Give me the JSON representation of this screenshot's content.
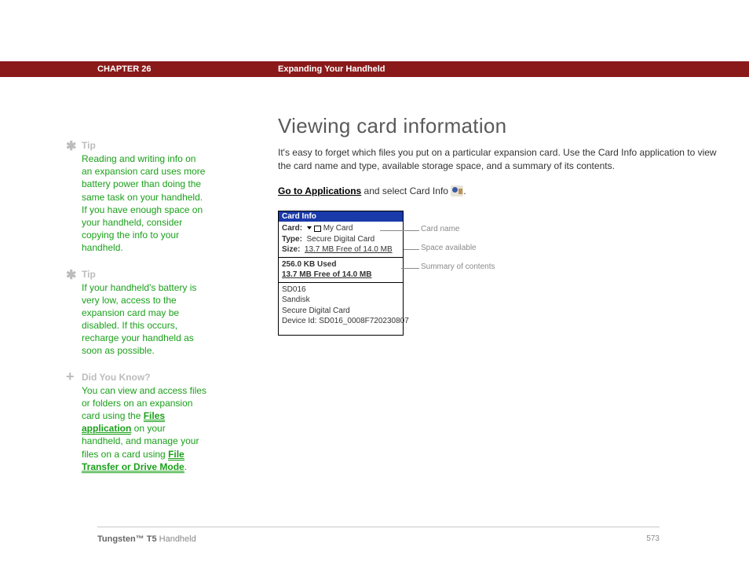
{
  "header": {
    "chapter": "CHAPTER 26",
    "title": "Expanding Your Handheld"
  },
  "sidebar": {
    "tip1": {
      "label": "Tip",
      "body": "Reading and writing info on an expansion card uses more battery power than doing the same task on your handheld. If you have enough space on your handheld, consider copying the info to your handheld."
    },
    "tip2": {
      "label": "Tip",
      "body": "If your handheld's battery is very low, access to the expansion card may be disabled. If this occurs, recharge your handheld as soon as possible."
    },
    "dyk": {
      "label": "Did You Know?",
      "pre": "You can view and access files or folders on an expansion card using the ",
      "link1": "Files application",
      "mid": " on your handheld, and manage your files on a card using ",
      "link2": "File Transfer or Drive Mode",
      "post": "."
    }
  },
  "main": {
    "title": "Viewing card information",
    "intro": "It's easy to forget which files you put on a particular expansion card. Use the Card Info application to view the card name and type, available storage space, and a summary of its contents.",
    "step_link": "Go to Applications",
    "step_tail": " and select Card Info ",
    "step_tail2": "."
  },
  "card": {
    "title": "Card Info",
    "card_label": "Card:",
    "card_value": "My Card",
    "type_label": "Type:",
    "type_value": "Secure Digital Card",
    "size_label": "Size:",
    "size_value": "13.7 MB Free of 14.0 MB",
    "used": "256.0 KB Used",
    "free": "13.7 MB Free of 14.0 MB",
    "details": [
      "SD016",
      "Sandisk",
      "Secure Digital Card",
      "Device Id: SD016_0008F720230807"
    ]
  },
  "callouts": {
    "name": "Card name",
    "space": "Space available",
    "summary": "Summary of contents"
  },
  "footer": {
    "brand": "Tungsten™ T5",
    "product": " Handheld",
    "page": "573"
  }
}
